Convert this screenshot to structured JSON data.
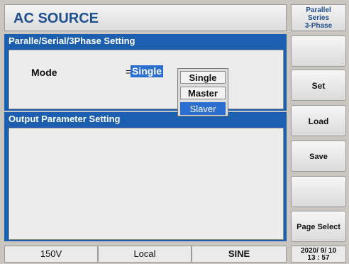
{
  "header": {
    "title": "AC SOURCE",
    "mode_indicator": [
      "Parallel",
      "Series",
      "3-Phase"
    ]
  },
  "parallel_section": {
    "title": "Paralle/Serial/3Phase  Setting",
    "mode_label": "Mode",
    "equals": "=",
    "mode_value": "Single",
    "options": [
      "Single",
      "Master",
      "Slaver"
    ],
    "selected_option": "Slaver"
  },
  "output_section": {
    "title": "Output  Parameter  Setting"
  },
  "side_buttons": [
    "",
    "Set",
    "Load",
    "Save",
    "",
    "Page Select"
  ],
  "status_bar": {
    "range": "150V",
    "control": "Local",
    "waveform": "SINE",
    "date": "2020/ 9/ 10",
    "time": "13 : 57"
  },
  "colors": {
    "header_blue": "#1c5fb0",
    "title_text": "#1e4f8f",
    "highlight": "#2a6fd0"
  }
}
